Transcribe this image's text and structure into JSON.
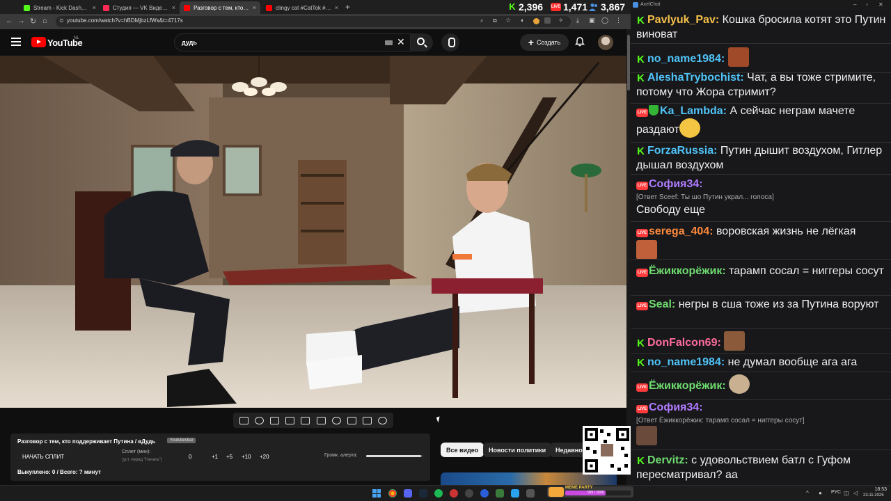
{
  "browser": {
    "tabs": [
      {
        "label": "Stream - Kick Dashboard",
        "color": "#53fc18"
      },
      {
        "label": "Студия — VK Видео Live",
        "color": "#ff2b55"
      },
      {
        "label": "Разговор с тем, кто подде",
        "color": "#ff0000"
      },
      {
        "label": "clingy cat #CatTok #CatFails20",
        "color": "#ff0000"
      }
    ],
    "url": "youtube.com/watch?v=hBDMjbzLfWs&t=4717s"
  },
  "stream_stats": {
    "kick": "2,396",
    "vk": "1,471",
    "total": "3,867"
  },
  "youtube": {
    "logo_text": "YouTube",
    "country_code": "NL",
    "search_value": "дудь",
    "create_label": "Создать"
  },
  "split_panel": {
    "title": "Разговор с тем, кто поддерживает Путина / вДудь",
    "badge": "Youtubesbar",
    "start_label": "НАЧАТЬ СПЛИТ",
    "split_label": "Сплит (мин):",
    "split_hint": "(уст. перед \"Начать\")",
    "current": "0",
    "increments": [
      "+1",
      "+5",
      "+10",
      "+20"
    ],
    "volume_label": "Громк. алерта:",
    "volume_level": 0.98,
    "bought": "Выкуплено: 0 / Всего: ? минут"
  },
  "chips": [
    "Все видео",
    "Новости политики",
    "Недавно"
  ],
  "chat": {
    "title": "AxelChat",
    "messages": [
      {
        "platform": "kick",
        "user": "Pavlyuk_Pav",
        "color": "#f5c04a",
        "text": "Кошка бросила котят это Путин виноват"
      },
      {
        "platform": "kick",
        "user": "no_name1984",
        "color": "#4fc3f7",
        "text": ""
      },
      {
        "platform": "kick",
        "user": "AleshaTrybochist",
        "color": "#4fc3f7",
        "text": "Чат, а вы тоже стримите, потому что Жора стримит?"
      },
      {
        "platform": "vk",
        "user": "Ka_Lambda",
        "color": "#4fc3f7",
        "text": "А сейчас неграм мачете раздают"
      },
      {
        "platform": "kick",
        "user": "ForzaRussia",
        "color": "#4fc3f7",
        "text": "Путин дышит воздухом, Гитлер дышал воздухом"
      },
      {
        "platform": "vk",
        "user": "София34",
        "color": "#b07cff",
        "reply": "[Ответ Sceef: Ты шо Путин украл... голоса]",
        "text": "Свободу еще"
      },
      {
        "platform": "vk",
        "user": "serega_404",
        "color": "#ff8a3d",
        "text": "воровская жизнь не лёгкая"
      },
      {
        "platform": "vk",
        "user": "Ёжиккорёжик",
        "color": "#6fdc6f",
        "text": "тарамп сосал = ниггеры сосут"
      },
      {
        "platform": "vk",
        "user": "Seal",
        "color": "#6fdc6f",
        "text": "негры в сша тоже из за Путина воруют"
      },
      {
        "platform": "kick",
        "user": "DonFalcon69",
        "color": "#ff6b9a",
        "text": ""
      },
      {
        "platform": "kick",
        "user": "no_name1984",
        "color": "#4fc3f7",
        "text": "не думал вообще ага ага"
      },
      {
        "platform": "vk",
        "user": "Ёжиккорёжик",
        "color": "#6fdc6f",
        "text": ""
      },
      {
        "platform": "vk",
        "user": "София34",
        "color": "#b07cff",
        "reply": "[Ответ Ёжиккорёжик: тарамп сосал = ниггеры сосут]",
        "text": ""
      },
      {
        "platform": "kick",
        "user": "Dervitz",
        "color": "#6fdc6f",
        "text": "с удовольствием батл с Гуфом пересматривал? аа"
      }
    ]
  },
  "taskbar": {
    "meme_label": "MEME PARTY",
    "meme_value": "925 / 1500",
    "meme_progress": 0.62,
    "lang": "РУС",
    "time": "18:53",
    "date": "23.11.2025"
  }
}
